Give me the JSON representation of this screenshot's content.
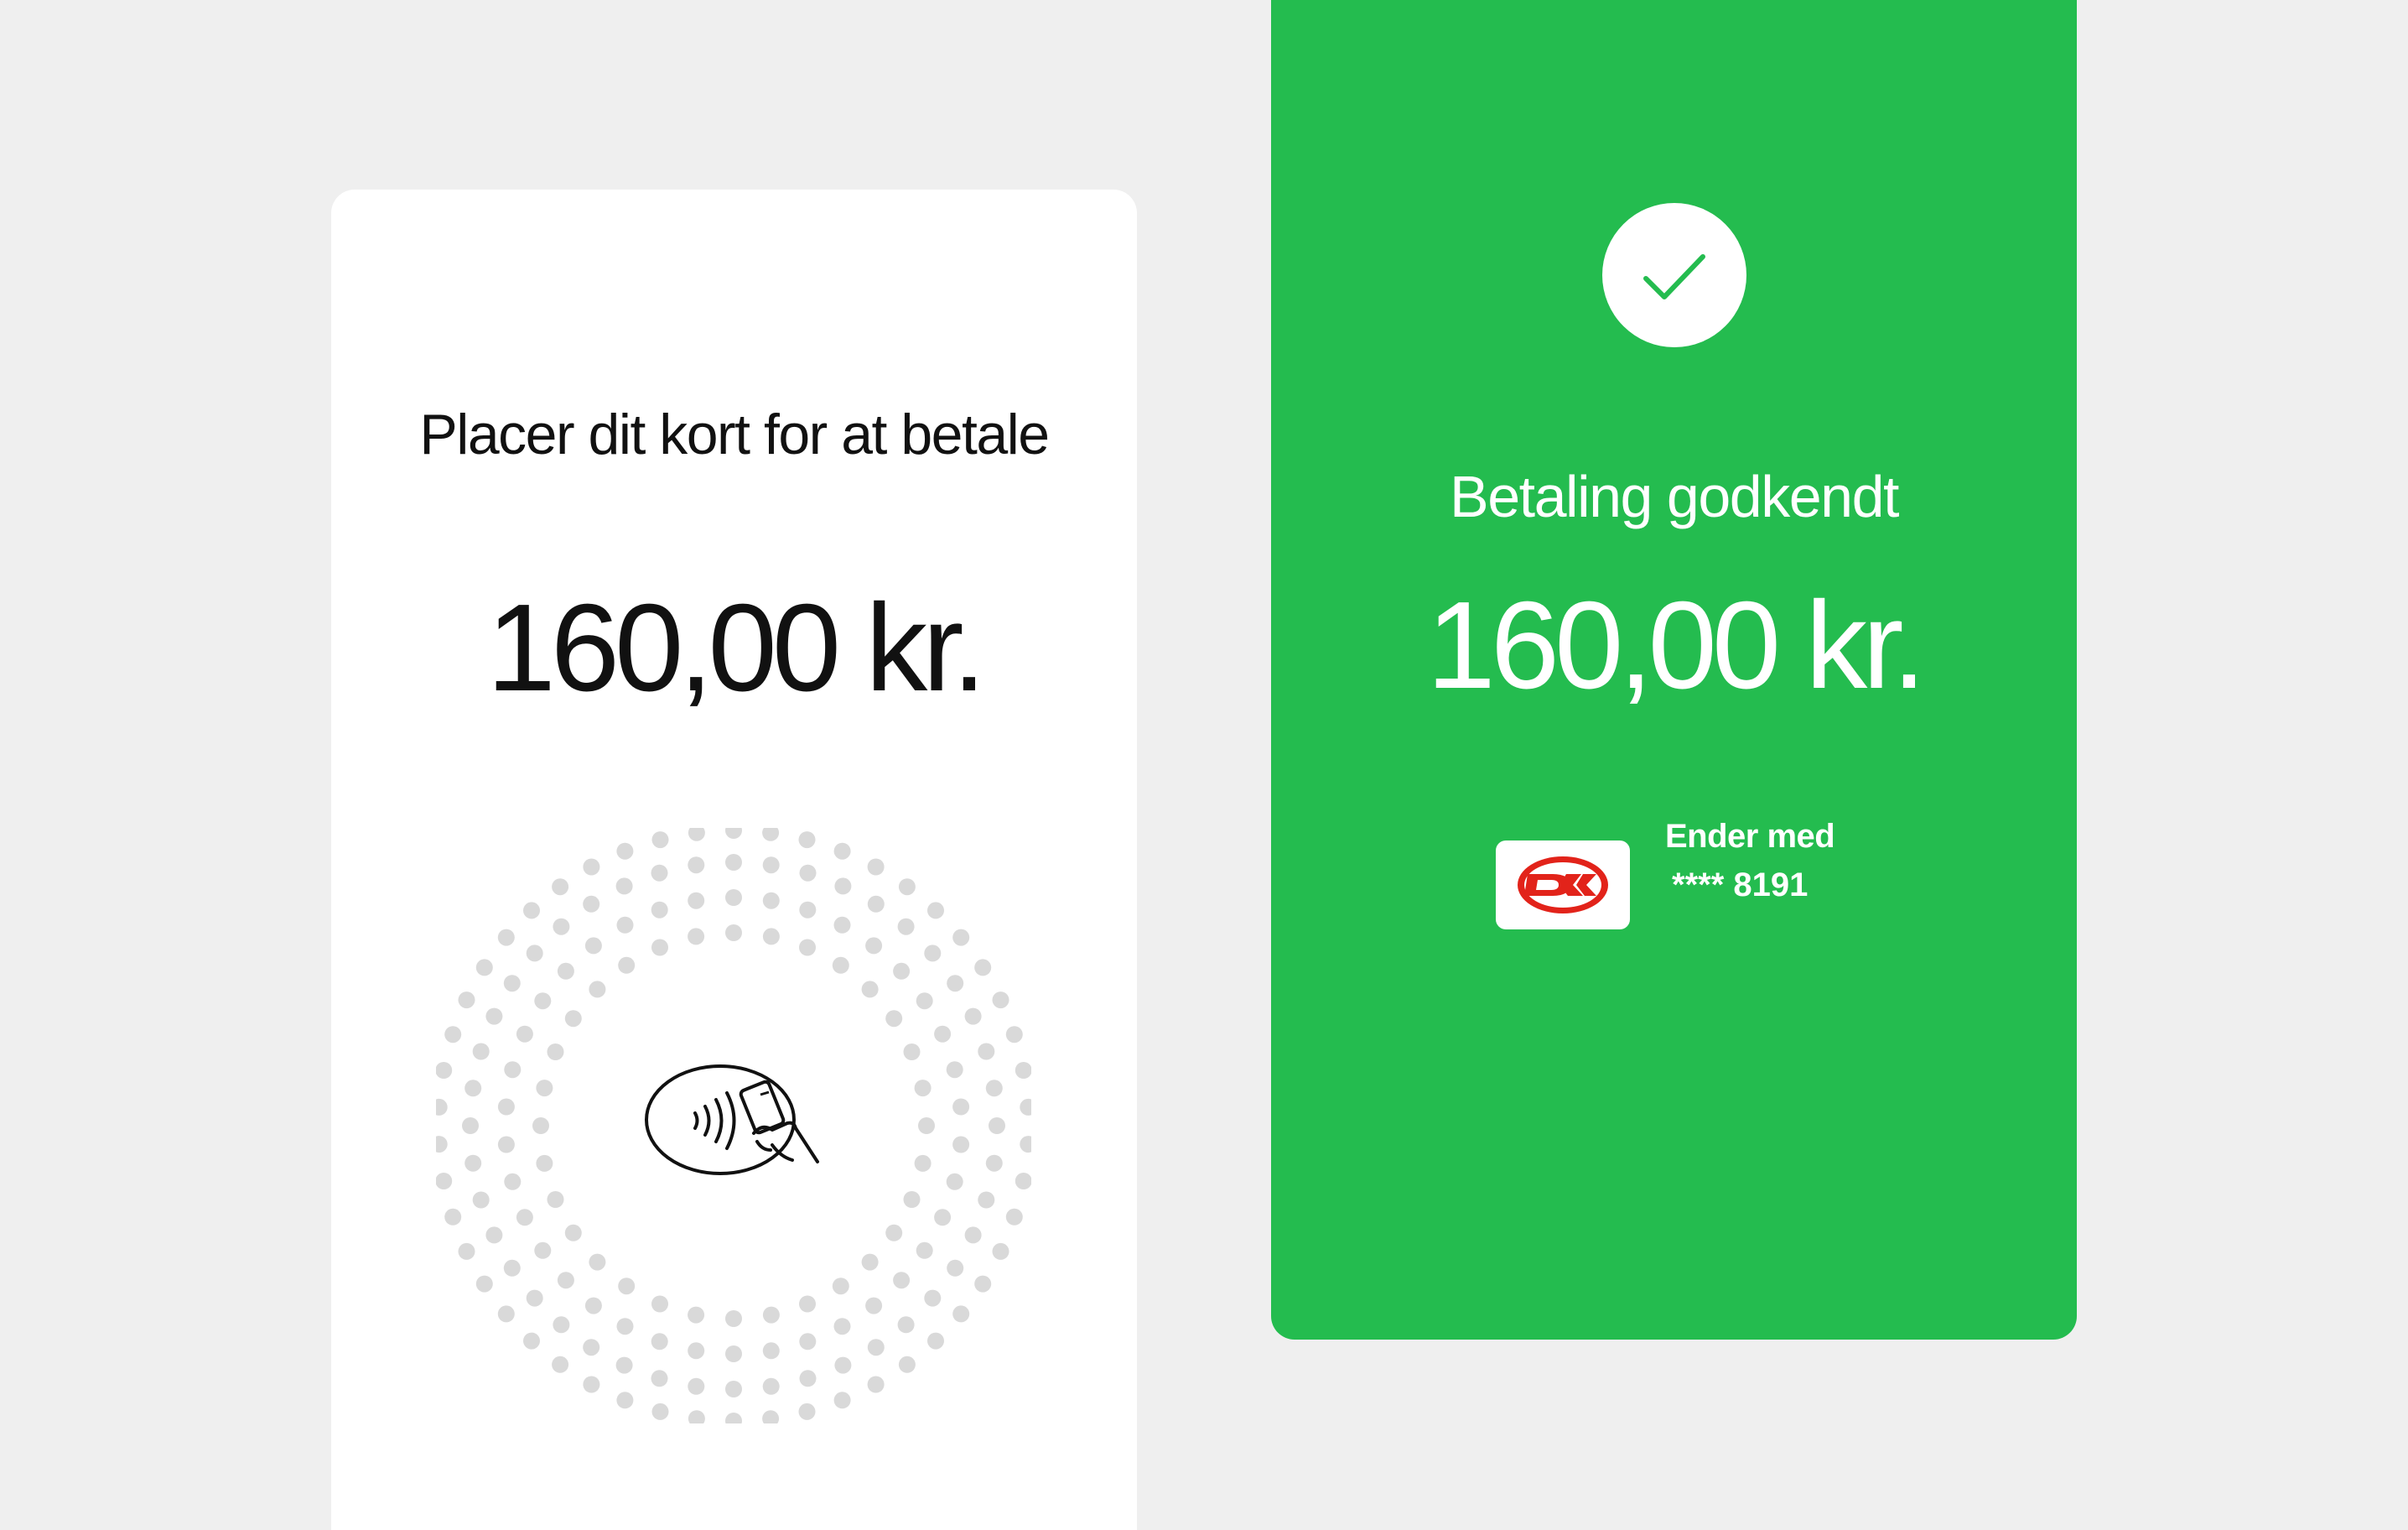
{
  "prompt_screen": {
    "title": "Placer dit kort for at betale",
    "amount": "160,00 kr.",
    "icon": "contactless-tap-icon"
  },
  "approved_screen": {
    "icon": "checkmark-icon",
    "title": "Betaling godkendt",
    "amount": "160,00 kr.",
    "card_brand_icon": "dankort-logo-icon",
    "ends_with_label": "Ender med",
    "card_number_masked": "**** 8191"
  },
  "colors": {
    "background": "#efefef",
    "success_green": "#24bc4f",
    "card_white": "#ffffff",
    "dot_grey": "#d9d9d9",
    "dankort_red": "#e2231a"
  }
}
